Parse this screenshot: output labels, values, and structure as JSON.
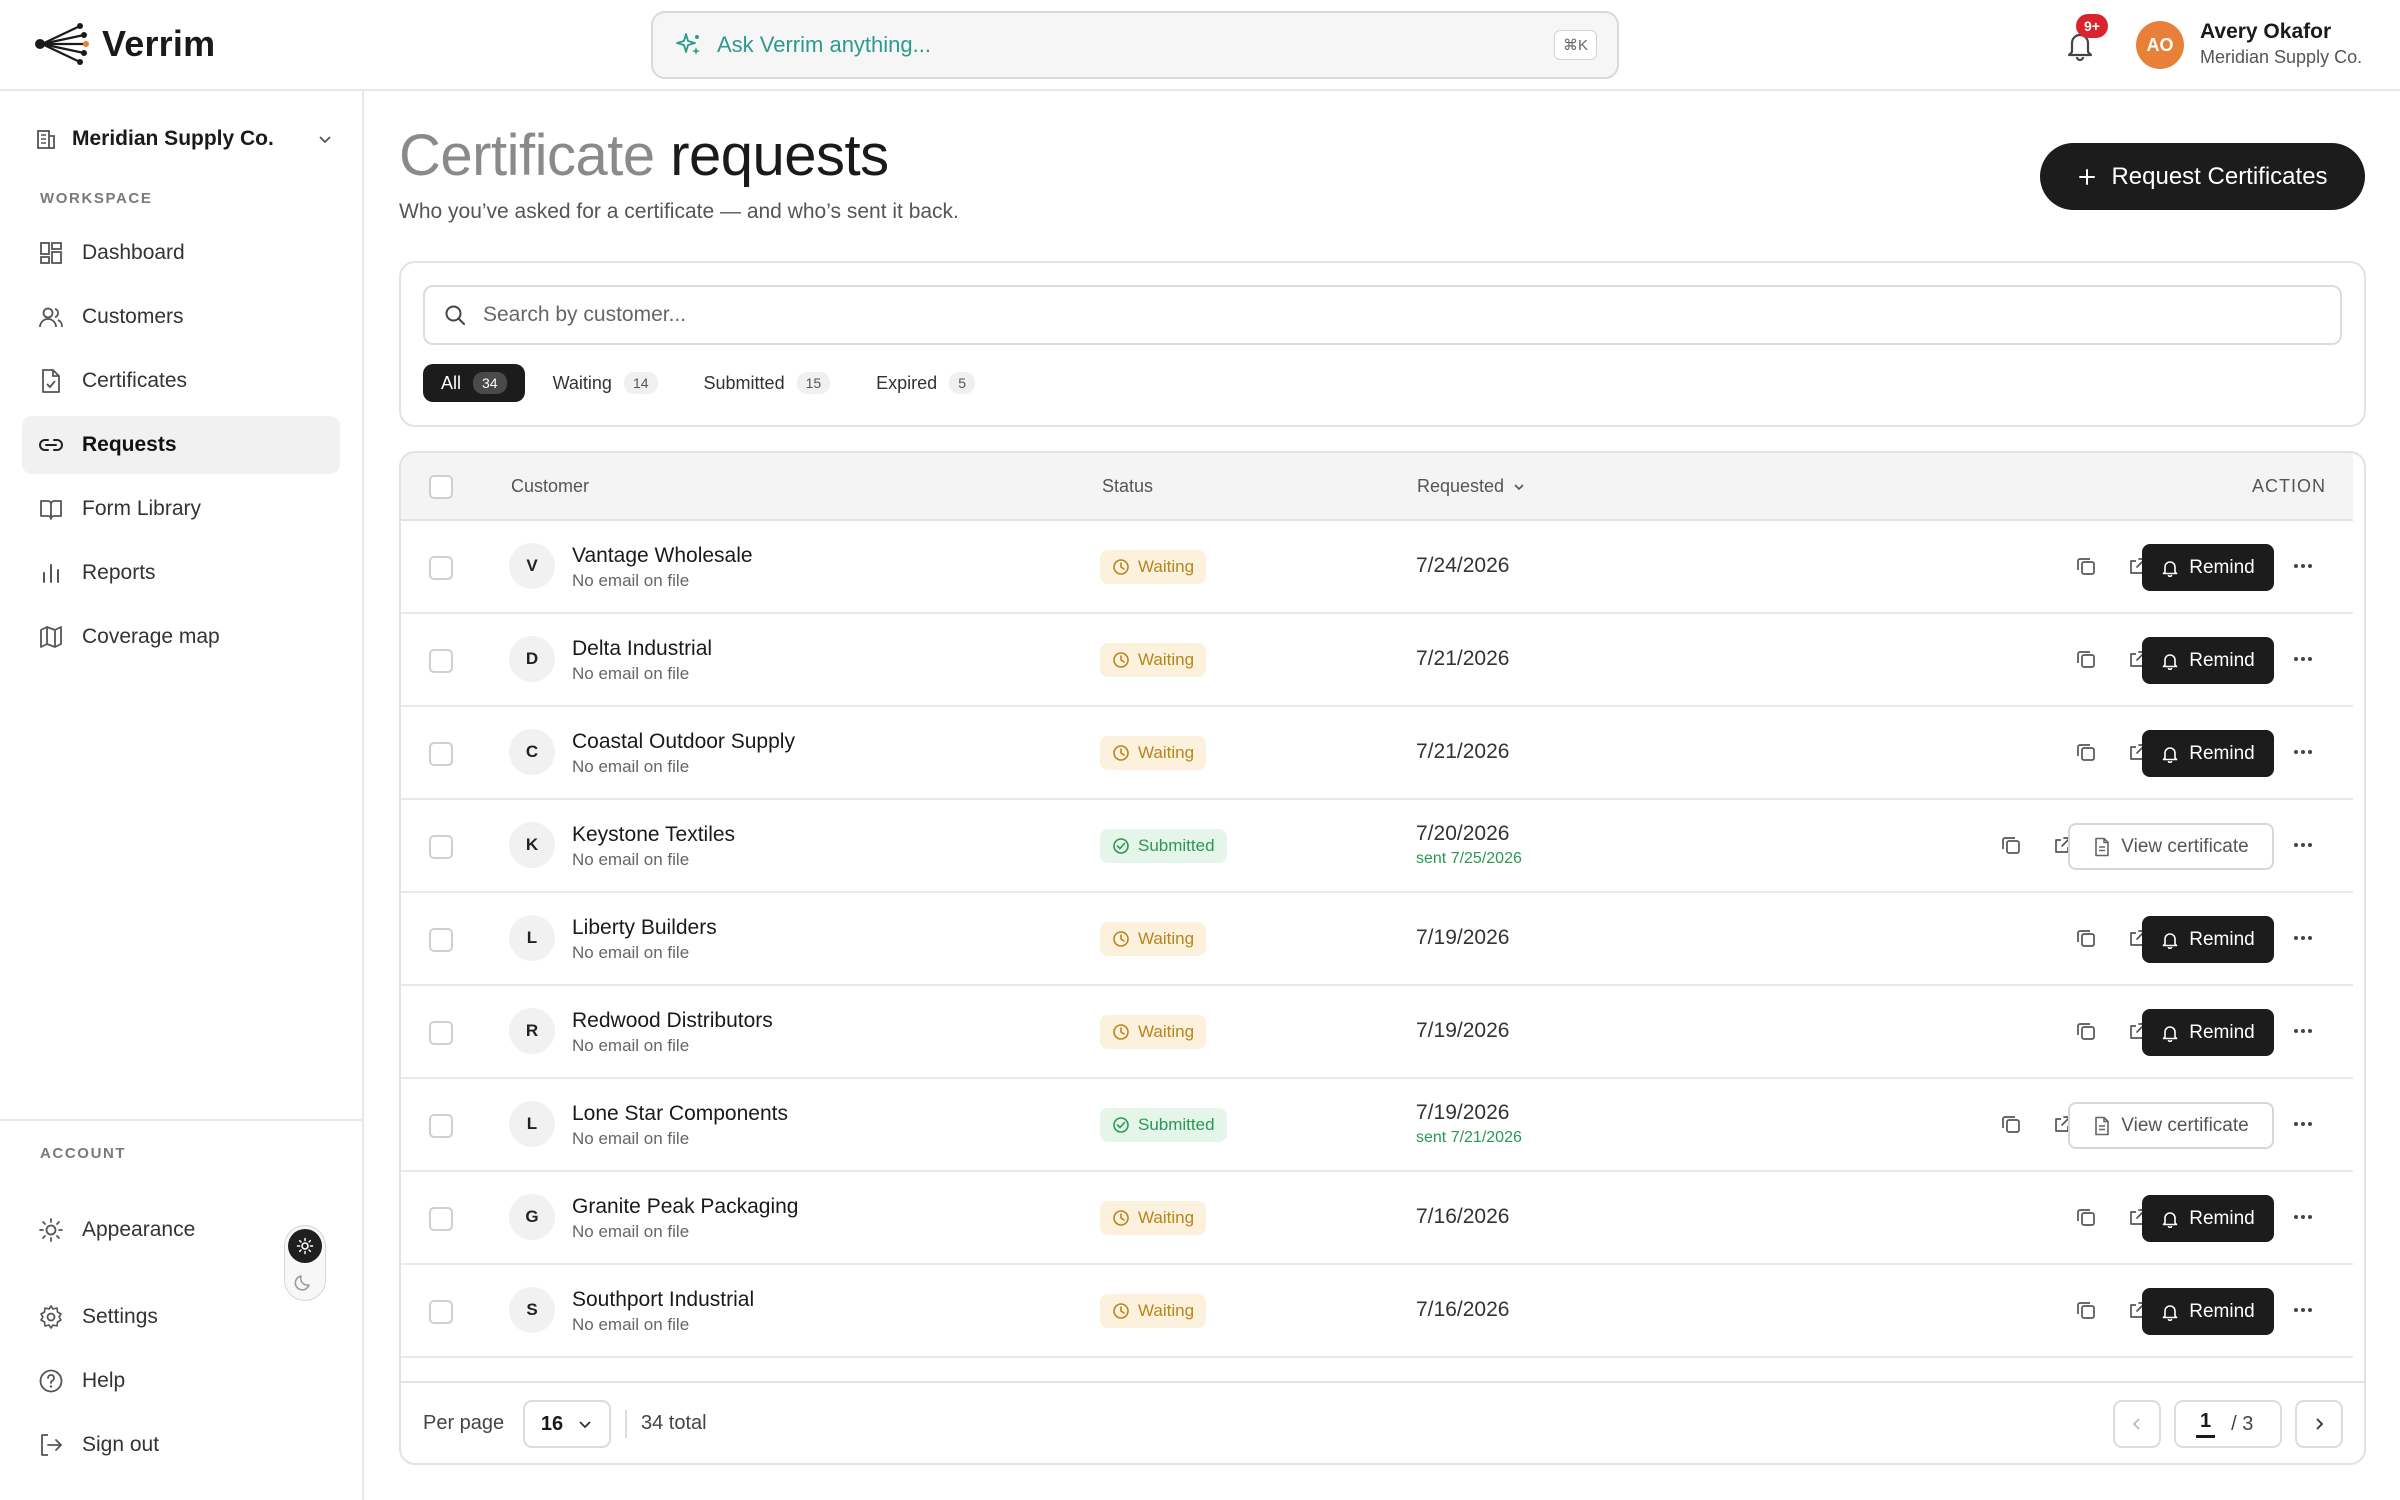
{
  "app": {
    "name": "Verrim",
    "ask_placeholder": "Ask Verrim anything...",
    "ask_shortcut": "⌘K",
    "notification_badge": "9+"
  },
  "user": {
    "initials": "AO",
    "name": "Avery Okafor",
    "org": "Meridian Supply Co."
  },
  "sidebar": {
    "org_switcher": "Meridian Supply Co.",
    "workspace_label": "WORKSPACE",
    "items": [
      {
        "label": "Dashboard",
        "icon": "dashboard-icon"
      },
      {
        "label": "Customers",
        "icon": "users-icon"
      },
      {
        "label": "Certificates",
        "icon": "file-check-icon"
      },
      {
        "label": "Requests",
        "icon": "link-icon",
        "active": true
      },
      {
        "label": "Form Library",
        "icon": "book-icon"
      },
      {
        "label": "Reports",
        "icon": "bar-chart-icon"
      },
      {
        "label": "Coverage map",
        "icon": "map-icon"
      }
    ],
    "account_label": "ACCOUNT",
    "appearance": "Appearance",
    "settings": "Settings",
    "help": "Help",
    "sign_out": "Sign out"
  },
  "page": {
    "title_light": "Certificate",
    "title_strong": "requests",
    "subtitle": "Who you’ve asked for a certificate — and who’s sent it back.",
    "primary_button": "Request Certificates",
    "search_placeholder": "Search by customer...",
    "filters": [
      {
        "label": "All",
        "count": "34",
        "active": true
      },
      {
        "label": "Waiting",
        "count": "14"
      },
      {
        "label": "Submitted",
        "count": "15"
      },
      {
        "label": "Expired",
        "count": "5"
      }
    ]
  },
  "table": {
    "columns": {
      "customer": "Customer",
      "status": "Status",
      "requested": "Requested",
      "action": "ACTION"
    },
    "remind_label": "Remind",
    "view_label": "View certificate",
    "rows": [
      {
        "initial": "V",
        "name": "Vantage Wholesale",
        "email": "No email on file",
        "status": "Waiting",
        "requested": "7/24/2026",
        "sent": ""
      },
      {
        "initial": "D",
        "name": "Delta Industrial",
        "email": "No email on file",
        "status": "Waiting",
        "requested": "7/21/2026",
        "sent": ""
      },
      {
        "initial": "C",
        "name": "Coastal Outdoor Supply",
        "email": "No email on file",
        "status": "Waiting",
        "requested": "7/21/2026",
        "sent": ""
      },
      {
        "initial": "K",
        "name": "Keystone Textiles",
        "email": "No email on file",
        "status": "Submitted",
        "requested": "7/20/2026",
        "sent": "sent 7/25/2026"
      },
      {
        "initial": "L",
        "name": "Liberty Builders",
        "email": "No email on file",
        "status": "Waiting",
        "requested": "7/19/2026",
        "sent": ""
      },
      {
        "initial": "R",
        "name": "Redwood Distributors",
        "email": "No email on file",
        "status": "Waiting",
        "requested": "7/19/2026",
        "sent": ""
      },
      {
        "initial": "L",
        "name": "Lone Star Components",
        "email": "No email on file",
        "status": "Submitted",
        "requested": "7/19/2026",
        "sent": "sent 7/21/2026"
      },
      {
        "initial": "G",
        "name": "Granite Peak Packaging",
        "email": "No email on file",
        "status": "Waiting",
        "requested": "7/16/2026",
        "sent": ""
      },
      {
        "initial": "S",
        "name": "Southport Industrial",
        "email": "No email on file",
        "status": "Waiting",
        "requested": "7/16/2026",
        "sent": ""
      }
    ]
  },
  "pagination": {
    "per_page_label": "Per page",
    "per_page_value": "16",
    "total": "34 total",
    "current_page": "1",
    "page_of": "/ 3"
  }
}
